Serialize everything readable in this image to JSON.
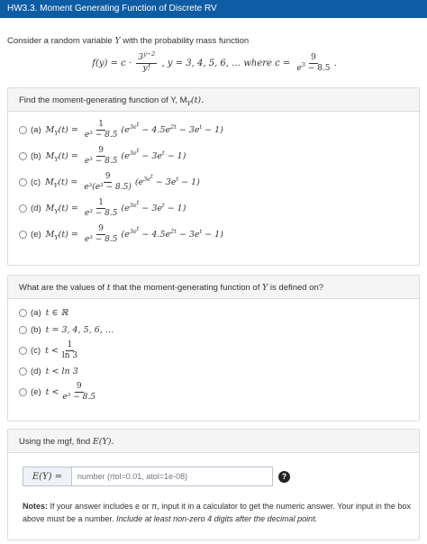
{
  "title": "HW3.3. Moment Generating Function of Discrete RV",
  "intro": {
    "text": "Consider a random variable",
    "var": "Y",
    "text2": "with the probability mass function"
  },
  "pmf": {
    "lhs": "f(y) = c ·",
    "num": "3",
    "num_exp": "y−2",
    "den": "y!",
    "domain": ",   y = 3, 4, 5, 6, … where c =",
    "c_num": "9",
    "c_den": "e",
    "c_den_exp": "3",
    "c_den_tail": " − 8.5",
    "tail": "."
  },
  "q1": {
    "prompt": "Find the moment-generating function of Y, M",
    "prompt_sub": "Y",
    "prompt_tail": "(t).",
    "options": [
      {
        "label": "(a)",
        "lhs": "M",
        "sub": "Y",
        "lhs2": "(t) =",
        "num": "1",
        "den": "e³ − 8.5",
        "body": "(e",
        "e1": "3e",
        "e1b": "t",
        "body2": " − 4.5e",
        "e2": "2t",
        "body3": " − 3e",
        "e3": "t",
        "body4": " − 1)"
      },
      {
        "label": "(b)",
        "lhs": "M",
        "sub": "Y",
        "lhs2": "(t) =",
        "num": "9",
        "den": "e³ − 8.5",
        "body": "(e",
        "e1": "3e",
        "e1b": "t",
        "body2": " − 3e",
        "e2": "t",
        "body3": " − 1)",
        "e3": "",
        "body4": ""
      },
      {
        "label": "(c)",
        "lhs": "M",
        "sub": "Y",
        "lhs2": "(t) =",
        "num": "9",
        "den": "e³(e³ − 8.5)",
        "body": "(e",
        "e1": "3e",
        "e1b": "t",
        "body2": " − 3e",
        "e2": "t",
        "body3": " − 1)",
        "e3": "",
        "body4": ""
      },
      {
        "label": "(d)",
        "lhs": "M",
        "sub": "Y",
        "lhs2": "(t) =",
        "num": "1",
        "den": "e³ − 8.5",
        "body": "(e",
        "e1": "3e",
        "e1b": "t",
        "body2": " − 3e",
        "e2": "t",
        "body3": " − 1)",
        "e3": "",
        "body4": ""
      },
      {
        "label": "(e)",
        "lhs": "M",
        "sub": "Y",
        "lhs2": "(t) =",
        "num": "9",
        "den": "e³ − 8.5",
        "body": "(e",
        "e1": "3e",
        "e1b": "t",
        "body2": " − 4.5e",
        "e2": "2t",
        "body3": " − 3e",
        "e3": "t",
        "body4": " − 1)"
      }
    ]
  },
  "q2": {
    "prompt": "What are the values of",
    "prompt_var": "t",
    "prompt2": "that the moment-generating function of",
    "prompt_var2": "Y",
    "prompt3": "is defined on?",
    "options": [
      {
        "label": "(a)",
        "expr": "t ∈ ℝ"
      },
      {
        "label": "(b)",
        "expr": "t = 3, 4, 5, 6, …"
      },
      {
        "label": "(c)",
        "expr": "t <",
        "num": "1",
        "den": "ln 3"
      },
      {
        "label": "(d)",
        "expr": "t < ln 3"
      },
      {
        "label": "(e)",
        "expr": "t <",
        "num": "9",
        "den": "e³ − 8.5"
      }
    ]
  },
  "q3": {
    "prompt": "Using the mgf, find",
    "prompt_expr": "E(Y).",
    "answer_prefix": "E(Y) =",
    "answer_placeholder": "number (rtol=0.01, atol=1e-08)",
    "help_glyph": "?",
    "notes_bold": "Notes:",
    "notes_text": " If your answer includes e or π, input it in a calculator to get the numeric answer. Your input in the box above must be a number.",
    "notes_italic": " Include at least non-zero 4 digits after the decimal point."
  }
}
